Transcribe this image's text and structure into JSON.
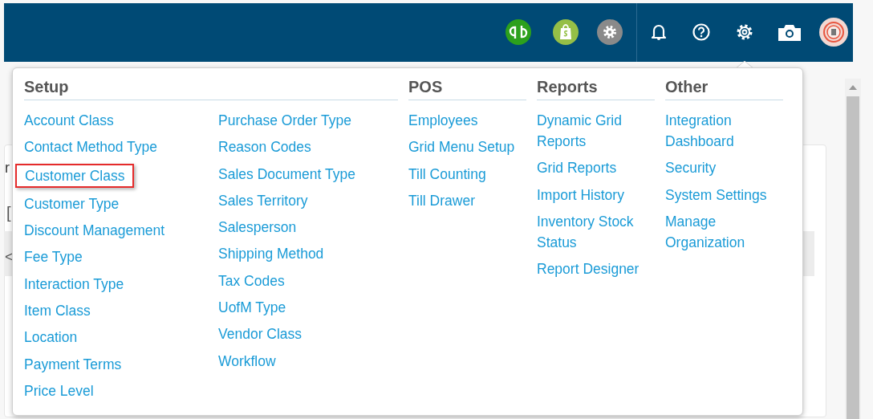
{
  "background_fragments": [
    {
      "text": "r"
    },
    {
      "text": "["
    },
    {
      "text": "<"
    }
  ],
  "menu": {
    "sections": [
      {
        "title": "Setup",
        "columns": [
          [
            {
              "label": "Account Class",
              "highlighted": false
            },
            {
              "label": "Contact Method Type",
              "highlighted": false
            },
            {
              "label": "Customer Class",
              "highlighted": true
            },
            {
              "label": "Customer Type",
              "highlighted": false
            },
            {
              "label": "Discount Management",
              "highlighted": false
            },
            {
              "label": "Fee Type",
              "highlighted": false
            },
            {
              "label": "Interaction Type",
              "highlighted": false
            },
            {
              "label": "Item Class",
              "highlighted": false
            },
            {
              "label": "Location",
              "highlighted": false
            },
            {
              "label": "Payment Terms",
              "highlighted": false
            },
            {
              "label": "Price Level",
              "highlighted": false
            }
          ],
          [
            {
              "label": "Purchase Order Type",
              "highlighted": false
            },
            {
              "label": "Reason Codes",
              "highlighted": false
            },
            {
              "label": "Sales Document Type",
              "highlighted": false
            },
            {
              "label": "Sales Territory",
              "highlighted": false
            },
            {
              "label": "Salesperson",
              "highlighted": false
            },
            {
              "label": "Shipping Method",
              "highlighted": false
            },
            {
              "label": "Tax Codes",
              "highlighted": false
            },
            {
              "label": "UofM Type",
              "highlighted": false
            },
            {
              "label": "Vendor Class",
              "highlighted": false
            },
            {
              "label": "Workflow",
              "highlighted": false
            }
          ]
        ]
      },
      {
        "title": "POS",
        "columns": [
          [
            {
              "label": "Employees",
              "highlighted": false
            },
            {
              "label": "Grid Menu Setup",
              "highlighted": false
            },
            {
              "label": "Till Counting",
              "highlighted": false
            },
            {
              "label": "Till Drawer",
              "highlighted": false
            }
          ]
        ]
      },
      {
        "title": "Reports",
        "columns": [
          [
            {
              "label": "Dynamic Grid Reports",
              "highlighted": false
            },
            {
              "label": "Grid Reports",
              "highlighted": false
            },
            {
              "label": "Import History",
              "highlighted": false
            },
            {
              "label": "Inventory Stock Status",
              "highlighted": false
            },
            {
              "label": "Report Designer",
              "highlighted": false
            }
          ]
        ]
      },
      {
        "title": "Other",
        "columns": [
          [
            {
              "label": "Integration Dashboard",
              "highlighted": false
            },
            {
              "label": "Security",
              "highlighted": false
            },
            {
              "label": "System Settings",
              "highlighted": false
            },
            {
              "label": "Manage Organization",
              "highlighted": false
            }
          ]
        ]
      }
    ]
  }
}
